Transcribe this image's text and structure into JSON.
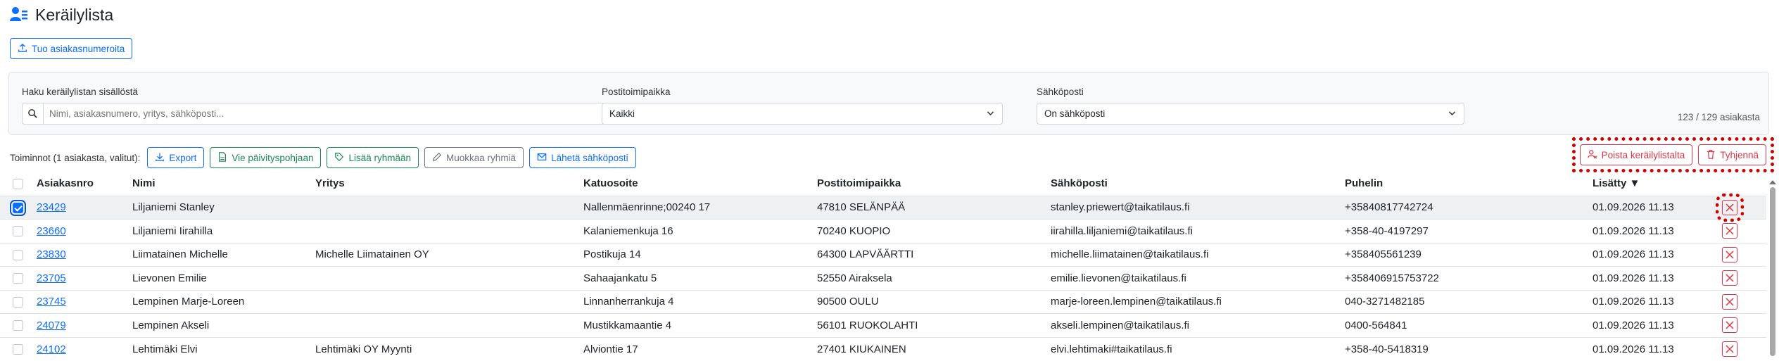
{
  "page": {
    "title": "Keräilylista"
  },
  "import_button": {
    "label": "Tuo asiakasnumeroita"
  },
  "filters": {
    "search_label": "Haku keräilylistan sisällöstä",
    "search_placeholder": "Nimi, asiakasnumero, yritys, sähköposti...",
    "postal_label": "Postitoimipaikka",
    "postal_value": "Kaikki",
    "email_label": "Sähköposti",
    "email_value": "On sähköposti",
    "count": "123 / 129 asiakasta"
  },
  "toolbar": {
    "label": "Toiminnot (1 asiakasta, valitut):",
    "export": "Export",
    "update_template": "Vie päivityspohjaan",
    "add_to_group": "Lisää ryhmään",
    "edit_groups": "Muokkaa ryhmiä",
    "send_email": "Lähetä sähköposti",
    "remove_from_list": "Poista keräilylistalta",
    "clear": "Tyhjennä"
  },
  "table": {
    "headers": {
      "customer_no": "Asiakasnro",
      "name": "Nimi",
      "company": "Yritys",
      "street": "Katuosoite",
      "postal": "Postitoimipaikka",
      "email": "Sähköposti",
      "phone": "Puhelin",
      "added": "Lisätty ▼"
    },
    "rows": [
      {
        "customer_no": "23429",
        "name": "Liljaniemi Stanley",
        "company": "",
        "street": "Nallenmäenrinne;00240 17",
        "postal": "47810 SELÄNPÄÄ",
        "email": "stanley.priewert@taikatilaus.fi",
        "phone": "+35840817742724",
        "added": "01.09.2026 11.13"
      },
      {
        "customer_no": "23660",
        "name": "Liljaniemi Iirahilla",
        "company": "",
        "street": "Kalaniemenkuja 16",
        "postal": "70240 KUOPIO",
        "email": "iirahilla.liljaniemi@taikatilaus.fi",
        "phone": "+358-40-4197297",
        "added": "01.09.2026 11.13"
      },
      {
        "customer_no": "23830",
        "name": "Liimatainen Michelle",
        "company": "Michelle Liimatainen OY",
        "street": "Postikuja 14",
        "postal": "64300 LAPVÄÄRTTI",
        "email": "michelle.liimatainen@taikatilaus.fi",
        "phone": "+358405561239",
        "added": "01.09.2026 11.13"
      },
      {
        "customer_no": "23705",
        "name": "Lievonen Emilie",
        "company": "",
        "street": "Sahaajankatu 5",
        "postal": "52550 Airaksela",
        "email": "emilie.lievonen@taikatilaus.fi",
        "phone": "+358406915753722",
        "added": "01.09.2026 11.13"
      },
      {
        "customer_no": "23745",
        "name": "Lempinen Marje-Loreen",
        "company": "",
        "street": "Linnanherrankuja 4",
        "postal": "90500 OULU",
        "email": "marje-loreen.lempinen@taikatilaus.fi",
        "phone": "040-3271482185",
        "added": "01.09.2026 11.13"
      },
      {
        "customer_no": "24079",
        "name": "Lempinen Akseli",
        "company": "",
        "street": "Mustikkamaantie 4",
        "postal": "56101 RUOKOLAHTI",
        "email": "akseli.lempinen@taikatilaus.fi",
        "phone": "0400-564841",
        "added": "01.09.2026 11.13"
      },
      {
        "customer_no": "24102",
        "name": "Lehtimäki Elvi",
        "company": "Lehtimäki OY Myynti",
        "street": "Alviontie 17",
        "postal": "27401 KIUKAINEN",
        "email": "elvi.lehtimaki#taikatilaus.fi",
        "phone": "+358-40-5418319",
        "added": "01.09.2026 11.13"
      }
    ]
  },
  "colors": {
    "primary": "#0d6efd",
    "success": "#198754",
    "danger": "#dc3545",
    "secondary": "#6c757d",
    "highlight": "#d00000"
  },
  "icons": [
    "users-icon",
    "upload-icon",
    "search-icon",
    "chevron-down-icon",
    "download-icon",
    "file-icon",
    "tag-icon",
    "edit-icon",
    "mail-icon",
    "user-remove-icon",
    "trash-icon",
    "close-icon"
  ]
}
